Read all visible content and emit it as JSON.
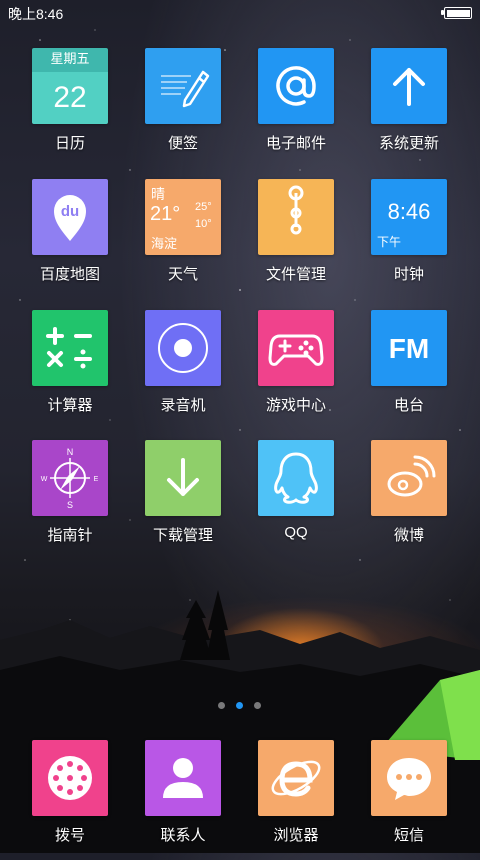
{
  "status_bar": {
    "time": "晚上8:46",
    "battery_level": 1.0
  },
  "apps": [
    {
      "label": "日历",
      "icon": "calendar-icon",
      "color": "#52d0c3",
      "weekday": "星期五",
      "day": "22"
    },
    {
      "label": "便签",
      "icon": "notepad-pencil-icon",
      "color": "#2f9ff0"
    },
    {
      "label": "电子邮件",
      "icon": "at-sign-icon",
      "color": "#2196f3"
    },
    {
      "label": "系统更新",
      "icon": "arrow-up-icon",
      "color": "#2196f3"
    },
    {
      "label": "百度地图",
      "icon": "map-pin-icon",
      "color": "#8f7ff2",
      "badge": "du"
    },
    {
      "label": "天气",
      "icon": "weather-icon",
      "color": "#f6a96b",
      "condition": "晴",
      "temp": "21°",
      "high": "25°",
      "low": "10°",
      "city": "海淀"
    },
    {
      "label": "文件管理",
      "icon": "file-tree-icon",
      "color": "#f6b556"
    },
    {
      "label": "时钟",
      "icon": "clock-icon",
      "color": "#2196f3",
      "time": "8:46",
      "ampm": "下午"
    },
    {
      "label": "计算器",
      "icon": "calculator-icon",
      "color": "#21c46c"
    },
    {
      "label": "录音机",
      "icon": "record-icon",
      "color": "#6f6ff5"
    },
    {
      "label": "游戏中心",
      "icon": "gamepad-icon",
      "color": "#f0428c"
    },
    {
      "label": "电台",
      "icon": "radio-fm-icon",
      "color": "#2196f3",
      "badge": "FM"
    },
    {
      "label": "指南针",
      "icon": "compass-icon",
      "color": "#a946c9",
      "n": "N",
      "s": "S",
      "w": "W",
      "e": "E"
    },
    {
      "label": "下载管理",
      "icon": "download-arrow-icon",
      "color": "#8fcf6a"
    },
    {
      "label": "QQ",
      "icon": "qq-penguin-icon",
      "color": "#4fc2f7"
    },
    {
      "label": "微博",
      "icon": "weibo-icon",
      "color": "#f6a96b"
    }
  ],
  "page_indicator": {
    "count": 3,
    "active": 2
  },
  "dock": [
    {
      "label": "拨号",
      "icon": "dialpad-icon",
      "color": "#f0428c"
    },
    {
      "label": "联系人",
      "icon": "contact-person-icon",
      "color": "#b957e6"
    },
    {
      "label": "浏览器",
      "icon": "browser-e-icon",
      "color": "#f6a96b"
    },
    {
      "label": "短信",
      "icon": "message-bubble-icon",
      "color": "#f6a96b"
    }
  ]
}
